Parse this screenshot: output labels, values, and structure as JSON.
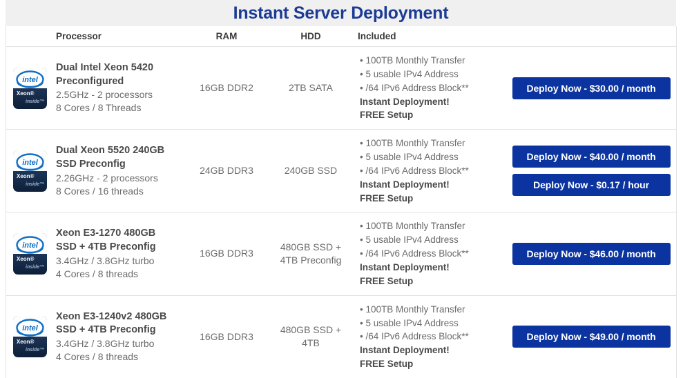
{
  "header": {
    "title": "Instant Server Deployment"
  },
  "table": {
    "columns": {
      "processor": "Processor",
      "ram": "RAM",
      "hdd": "HDD",
      "included": "Included",
      "action": ""
    },
    "rows": [
      {
        "badge": {
          "brand": "intel",
          "family": "Xeon",
          "tagline": "inside"
        },
        "processor": {
          "title_lines": [
            "Dual Intel Xeon 5420",
            "Preconfigured"
          ],
          "spec_lines": [
            "2.5GHz - 2 processors",
            "8 Cores / 8 Threads"
          ]
        },
        "ram": [
          "16GB DDR2"
        ],
        "hdd": [
          "2TB SATA"
        ],
        "included": [
          {
            "text": "• 100TB Monthly Transfer",
            "bold": false
          },
          {
            "text": "• 5 usable IPv4 Address",
            "bold": false
          },
          {
            "text": "• /64 IPv6 Address Block**",
            "bold": false
          },
          {
            "text": "Instant Deployment!",
            "bold": true
          },
          {
            "text": "FREE Setup",
            "bold": true
          }
        ],
        "buttons": [
          "Deploy Now - $30.00 / month"
        ]
      },
      {
        "badge": {
          "brand": "intel",
          "family": "Xeon",
          "tagline": "inside"
        },
        "processor": {
          "title_lines": [
            "Dual Xeon 5520 240GB",
            "SSD Preconfig"
          ],
          "spec_lines": [
            "2.26GHz - 2 processors",
            "8 Cores / 16 threads"
          ]
        },
        "ram": [
          "24GB DDR3"
        ],
        "hdd": [
          "240GB SSD"
        ],
        "included": [
          {
            "text": "• 100TB Monthly Transfer",
            "bold": false
          },
          {
            "text": "• 5 usable IPv4 Address",
            "bold": false
          },
          {
            "text": "• /64 IPv6 Address Block**",
            "bold": false
          },
          {
            "text": "Instant Deployment!",
            "bold": true
          },
          {
            "text": "FREE Setup",
            "bold": true
          }
        ],
        "buttons": [
          "Deploy Now - $40.00 / month",
          "Deploy Now - $0.17 / hour"
        ]
      },
      {
        "badge": {
          "brand": "intel",
          "family": "Xeon",
          "tagline": "inside"
        },
        "processor": {
          "title_lines": [
            "Xeon E3-1270 480GB",
            "SSD + 4TB Preconfig"
          ],
          "spec_lines": [
            "3.4GHz / 3.8GHz turbo",
            "4 Cores / 8 threads"
          ]
        },
        "ram": [
          "16GB DDR3"
        ],
        "hdd": [
          "480GB SSD +",
          "4TB Preconfig"
        ],
        "included": [
          {
            "text": "• 100TB Monthly Transfer",
            "bold": false
          },
          {
            "text": "• 5 usable IPv4 Address",
            "bold": false
          },
          {
            "text": "• /64 IPv6 Address Block**",
            "bold": false
          },
          {
            "text": "Instant Deployment!",
            "bold": true
          },
          {
            "text": "FREE Setup",
            "bold": true
          }
        ],
        "buttons": [
          "Deploy Now - $46.00 / month"
        ]
      },
      {
        "badge": {
          "brand": "intel",
          "family": "Xeon",
          "tagline": "inside"
        },
        "processor": {
          "title_lines": [
            "Xeon E3-1240v2 480GB",
            "SSD + 4TB Preconfig"
          ],
          "spec_lines": [
            "3.4GHz / 3.8GHz turbo",
            "4 Cores / 8 threads"
          ]
        },
        "ram": [
          "16GB DDR3"
        ],
        "hdd": [
          "480GB SSD +",
          "4TB"
        ],
        "included": [
          {
            "text": "• 100TB Monthly Transfer",
            "bold": false
          },
          {
            "text": "• 5 usable IPv4 Address",
            "bold": false
          },
          {
            "text": "• /64 IPv6 Address Block**",
            "bold": false
          },
          {
            "text": "Instant Deployment!",
            "bold": true
          },
          {
            "text": "FREE Setup",
            "bold": true
          }
        ],
        "buttons": [
          "Deploy Now - $49.00 / month"
        ]
      }
    ]
  },
  "colors": {
    "title": "#1b3b95",
    "button": "#0b34a0",
    "header_band": "#f0f0f1",
    "border": "#e2e2e4",
    "body_text": "#6b6b6e",
    "bold_text": "#4a4a4d",
    "badge_navy": "#12263f",
    "intel_blue": "#0f6fc6"
  }
}
